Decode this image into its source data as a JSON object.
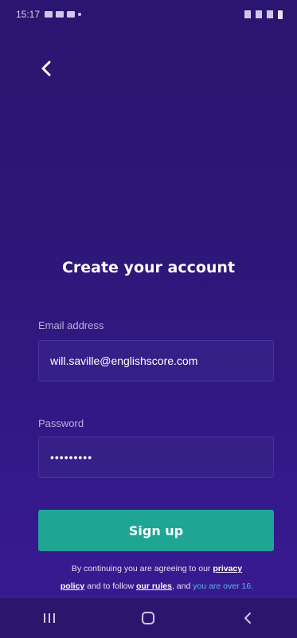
{
  "status_bar": {
    "time": "15:17"
  },
  "screen": {
    "title": "Create your account"
  },
  "form": {
    "email_label": "Email address",
    "email_value": "will.saville@englishscore.com",
    "password_label": "Password",
    "password_value": "•••••••••"
  },
  "signup_button": {
    "label": "Sign up"
  },
  "legal": {
    "part1": "By continuing you are agreeing to our ",
    "privacy_link_line1": "privacy",
    "privacy_link_line2": "policy",
    "part2": " and to follow ",
    "rules_link": "our rules",
    "part3": ", and ",
    "age_text": "you are over 16."
  },
  "nav_bar": {
    "recent_icon": "recent-apps-icon",
    "home_icon": "home-icon",
    "back_icon": "back-icon"
  },
  "colors": {
    "background": "#2d1778",
    "accent_button": "#1fa594",
    "age_text": "#53b8e6"
  }
}
